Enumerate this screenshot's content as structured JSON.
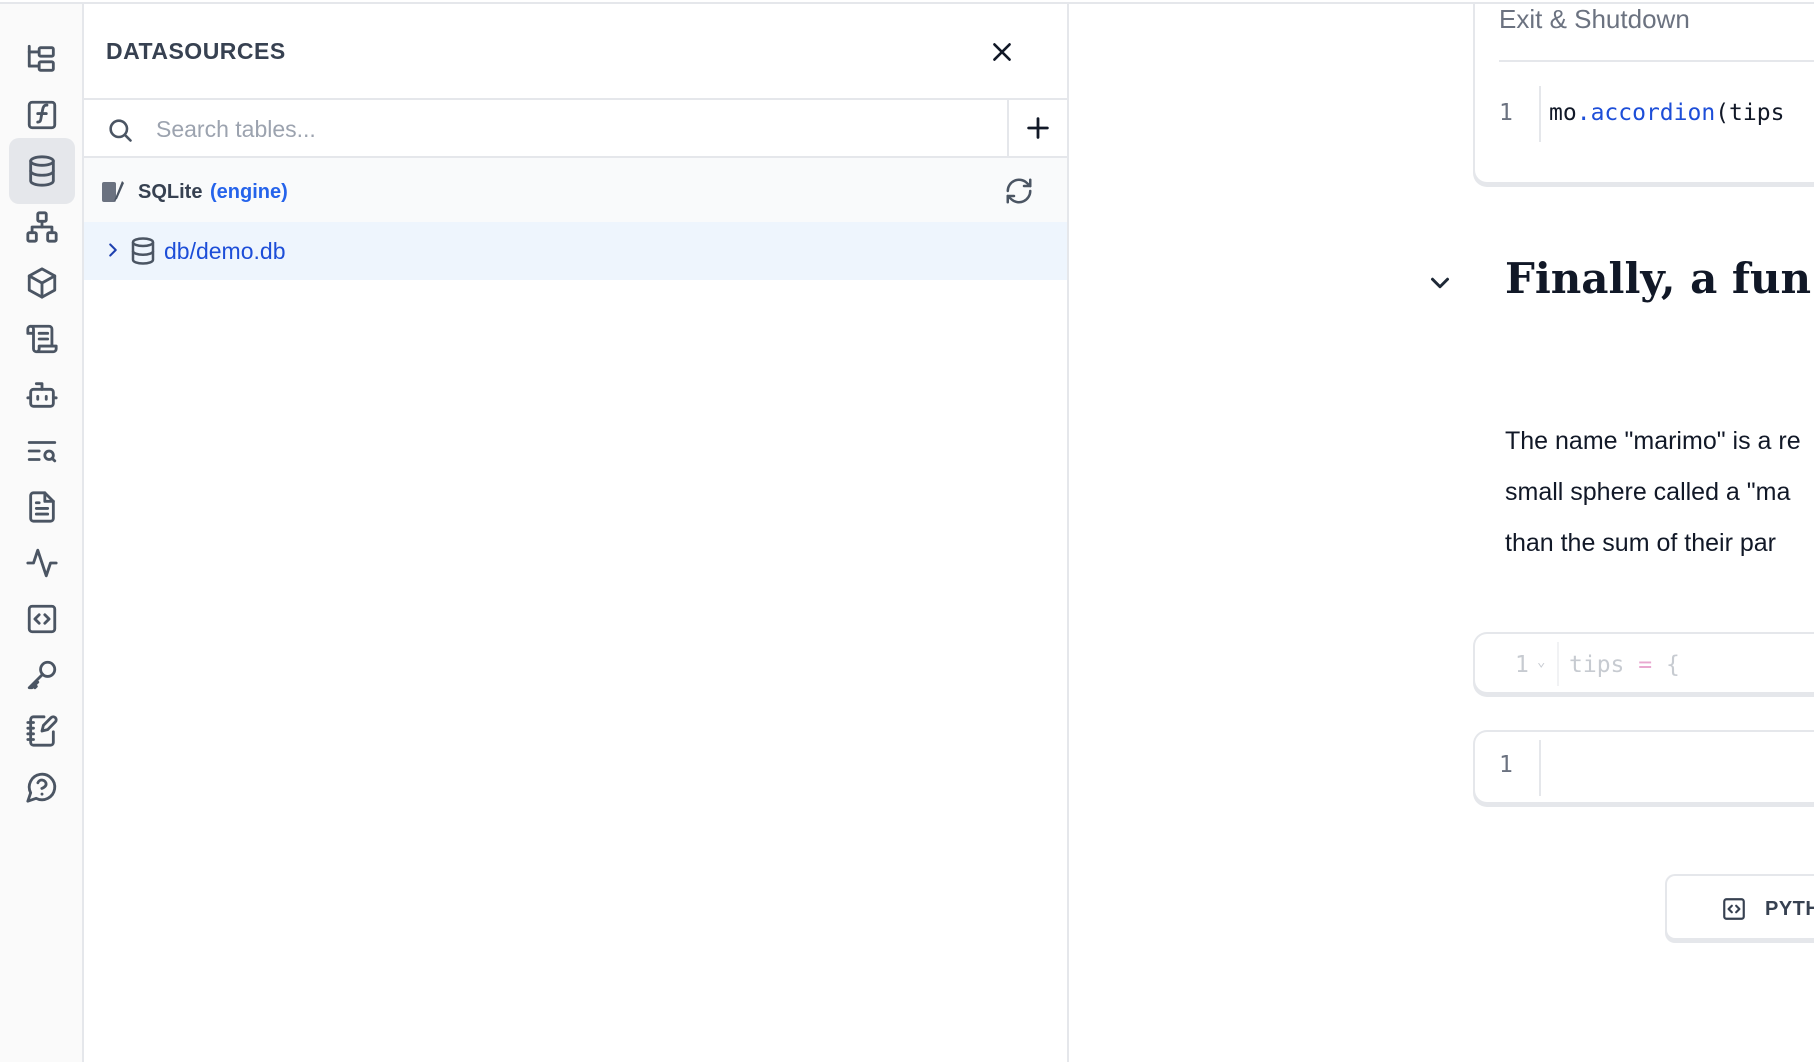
{
  "rail": {
    "items": [
      {
        "icon": "file-tree-icon"
      },
      {
        "icon": "function-icon"
      },
      {
        "icon": "database-icon",
        "active": true
      },
      {
        "icon": "dependency-graph-icon"
      },
      {
        "icon": "package-icon"
      },
      {
        "icon": "scroll-icon"
      },
      {
        "icon": "bot-icon"
      },
      {
        "icon": "text-search-icon"
      },
      {
        "icon": "document-icon"
      },
      {
        "icon": "activity-icon"
      },
      {
        "icon": "code-square-icon"
      },
      {
        "icon": "key-icon"
      },
      {
        "icon": "notebook-pen-icon"
      },
      {
        "icon": "help-chat-icon"
      }
    ]
  },
  "datasources": {
    "title": "DATASOURCES",
    "search_placeholder": "Search tables...",
    "engine": {
      "name": "SQLite",
      "tag": "(engine)",
      "icon": "sqlite-feather-icon"
    },
    "databases": [
      {
        "name": "db/demo.db",
        "expanded": false
      }
    ]
  },
  "notebook": {
    "exit_label": "Exit & Shutdown",
    "cell1": {
      "line": "1",
      "code_prefix": "mo",
      "code_dot": ".",
      "code_fn": "accordion",
      "code_rest": "(tips"
    },
    "heading": "Finally, a fun fac",
    "paragraph": [
      "The name \"marimo\" is a re",
      "small sphere called a \"ma",
      "than the sum of their par"
    ],
    "cell2": {
      "line": "1",
      "caret": "⌄",
      "code_var": "tips",
      "code_op": " = ",
      "code_rest": "{"
    },
    "cell3": {
      "line": "1"
    },
    "add_python_label": "PYTH"
  },
  "colors": {
    "accent": "#2563eb",
    "selected_row": "#eef5fd",
    "border": "#e5e7eb"
  }
}
